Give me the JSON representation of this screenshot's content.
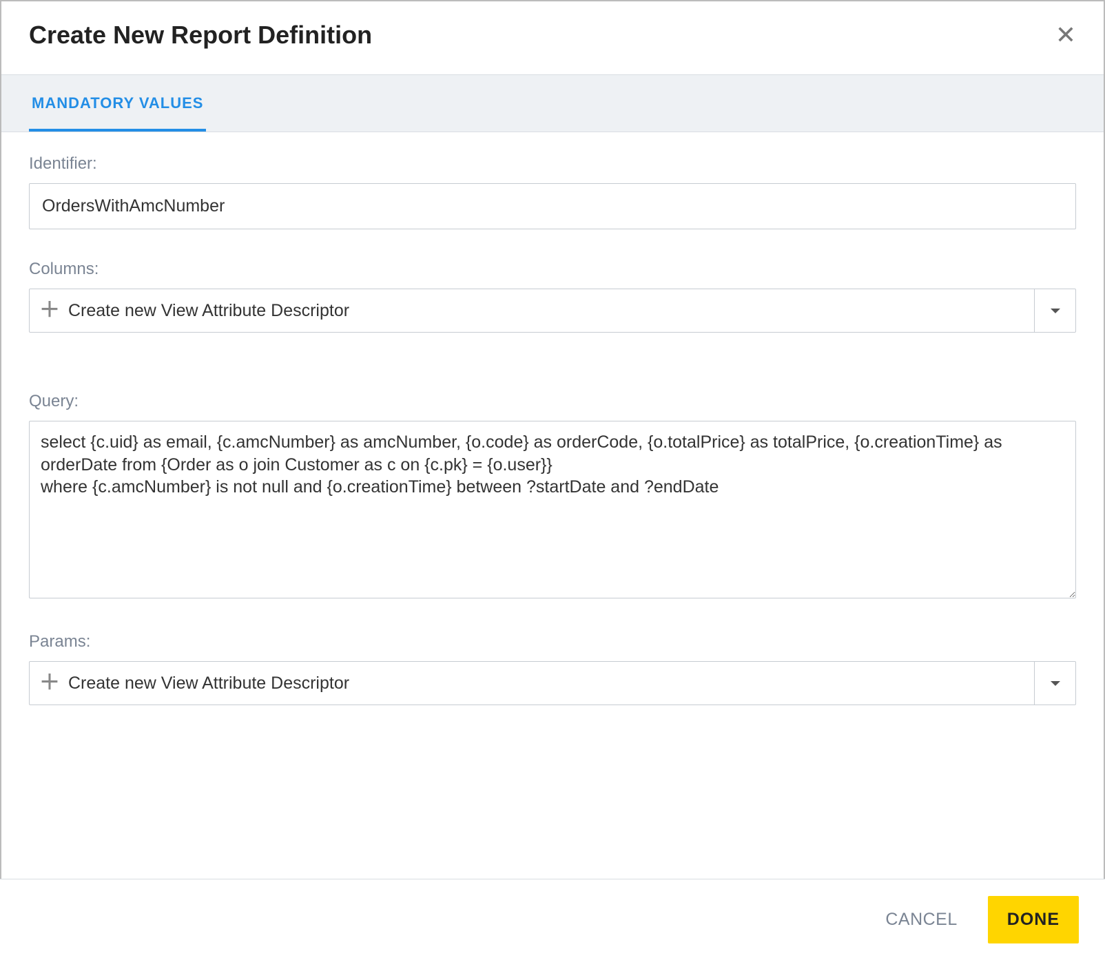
{
  "dialog": {
    "title": "Create New Report Definition"
  },
  "tabs": {
    "active": "MANDATORY VALUES"
  },
  "fields": {
    "identifier": {
      "label": "Identifier:",
      "value": "OrdersWithAmcNumber"
    },
    "columns": {
      "label": "Columns:",
      "action_text": "Create new View Attribute Descriptor"
    },
    "query": {
      "label": "Query:",
      "value": "select {c.uid} as email, {c.amcNumber} as amcNumber, {o.code} as orderCode, {o.totalPrice} as totalPrice, {o.creationTime} as orderDate from {Order as o join Customer as c on {c.pk} = {o.user}}\nwhere {c.amcNumber} is not null and {o.creationTime} between ?startDate and ?endDate"
    },
    "params": {
      "label": "Params:",
      "action_text": "Create new View Attribute Descriptor"
    }
  },
  "footer": {
    "cancel": "CANCEL",
    "done": "DONE"
  }
}
